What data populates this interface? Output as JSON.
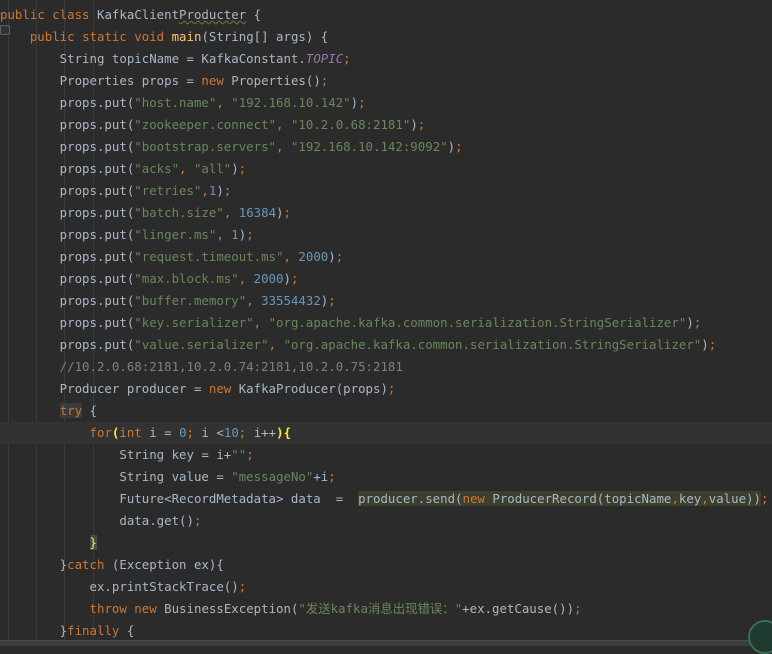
{
  "editor": {
    "lines": [
      [
        [
          "kw",
          "public "
        ],
        [
          "kw",
          "class "
        ],
        [
          "plain",
          "KafkaClient"
        ],
        [
          "wavy",
          "Producter"
        ],
        [
          "plain",
          " {"
        ]
      ],
      [
        [
          "plain",
          "    "
        ],
        [
          "kw",
          "public "
        ],
        [
          "kw",
          "static "
        ],
        [
          "kw",
          "void "
        ],
        [
          "fn",
          "main"
        ],
        [
          "plain",
          "(String[] args) {"
        ]
      ],
      [
        [
          "plain",
          "        String topicName = KafkaConstant."
        ],
        [
          "const",
          "TOPIC"
        ],
        [
          "kw",
          ";"
        ]
      ],
      [
        [
          "plain",
          "        Properties props = "
        ],
        [
          "kw",
          "new "
        ],
        [
          "plain",
          "Properties()"
        ],
        [
          "kw",
          ";"
        ]
      ],
      [
        [
          "plain",
          "        props.put("
        ],
        [
          "str",
          "\"host.name\""
        ],
        [
          "kw",
          ", "
        ],
        [
          "str",
          "\"192.168.10.142\""
        ],
        [
          "plain",
          ")"
        ],
        [
          "kw",
          ";"
        ]
      ],
      [
        [
          "plain",
          "        props.put("
        ],
        [
          "str",
          "\"zookeeper.connect\""
        ],
        [
          "kw",
          ", "
        ],
        [
          "str",
          "\"10.2.0.68:2181\""
        ],
        [
          "plain",
          ")"
        ],
        [
          "kw",
          ";"
        ]
      ],
      [
        [
          "plain",
          "        props.put("
        ],
        [
          "str",
          "\"bootstrap.servers\""
        ],
        [
          "kw",
          ", "
        ],
        [
          "str",
          "\"192.168.10.142:9092\""
        ],
        [
          "plain",
          ")"
        ],
        [
          "kw",
          ";"
        ]
      ],
      [
        [
          "plain",
          "        props.put("
        ],
        [
          "str",
          "\"acks\""
        ],
        [
          "kw",
          ", "
        ],
        [
          "str",
          "\"all\""
        ],
        [
          "plain",
          ")"
        ],
        [
          "kw",
          ";"
        ]
      ],
      [
        [
          "plain",
          "        props.put("
        ],
        [
          "str",
          "\"retries\""
        ],
        [
          "kw",
          ","
        ],
        [
          "num",
          "1"
        ],
        [
          "plain",
          ")"
        ],
        [
          "kw",
          ";"
        ]
      ],
      [
        [
          "plain",
          "        props.put("
        ],
        [
          "str",
          "\"batch.size\""
        ],
        [
          "kw",
          ", "
        ],
        [
          "num",
          "16384"
        ],
        [
          "plain",
          ")"
        ],
        [
          "kw",
          ";"
        ]
      ],
      [
        [
          "plain",
          "        props.put("
        ],
        [
          "str",
          "\"linger.ms\""
        ],
        [
          "kw",
          ", "
        ],
        [
          "num",
          "1"
        ],
        [
          "plain",
          ")"
        ],
        [
          "kw",
          ";"
        ]
      ],
      [
        [
          "plain",
          "        props.put("
        ],
        [
          "str",
          "\"request.timeout.ms\""
        ],
        [
          "kw",
          ", "
        ],
        [
          "num",
          "2000"
        ],
        [
          "plain",
          ")"
        ],
        [
          "kw",
          ";"
        ]
      ],
      [
        [
          "plain",
          "        props.put("
        ],
        [
          "str",
          "\"max.block.ms\""
        ],
        [
          "kw",
          ", "
        ],
        [
          "num",
          "2000"
        ],
        [
          "plain",
          ")"
        ],
        [
          "kw",
          ";"
        ]
      ],
      [
        [
          "plain",
          "        props.put("
        ],
        [
          "str",
          "\"buffer.memory\""
        ],
        [
          "kw",
          ", "
        ],
        [
          "num",
          "33554432"
        ],
        [
          "plain",
          ")"
        ],
        [
          "kw",
          ";"
        ]
      ],
      [
        [
          "plain",
          "        props.put("
        ],
        [
          "str",
          "\"key.serializer\""
        ],
        [
          "kw",
          ", "
        ],
        [
          "str",
          "\"org.apache.kafka.common.serialization.StringSerializer\""
        ],
        [
          "plain",
          ")"
        ],
        [
          "kw",
          ";"
        ]
      ],
      [
        [
          "plain",
          "        props.put("
        ],
        [
          "str",
          "\"value.serializer\""
        ],
        [
          "kw",
          ", "
        ],
        [
          "str",
          "\"org.apache.kafka.common.serialization.StringSerializer\""
        ],
        [
          "plain",
          ")"
        ],
        [
          "kw",
          ";"
        ]
      ],
      [
        [
          "cmt",
          "        //10.2.0.68:2181,10.2.0.74:2181,10.2.0.75:2181"
        ]
      ],
      [
        [
          "plain",
          "        Producer producer = "
        ],
        [
          "kw",
          "new "
        ],
        [
          "plain",
          "KafkaProducer(props)"
        ],
        [
          "kw",
          ";"
        ]
      ],
      [
        [
          "plain",
          "        "
        ],
        [
          "try-hl",
          "try"
        ],
        [
          "plain",
          " {"
        ]
      ],
      [
        [
          "plain",
          "            "
        ],
        [
          "kw",
          "for"
        ],
        [
          "brace-hl",
          "("
        ],
        [
          "kw",
          "int "
        ],
        [
          "plain",
          "i = "
        ],
        [
          "num",
          "0"
        ],
        [
          "kw",
          "; "
        ],
        [
          "plain",
          "i <"
        ],
        [
          "num",
          "10"
        ],
        [
          "kw",
          "; "
        ],
        [
          "plain",
          "i++"
        ],
        [
          "brace-hl",
          ")"
        ],
        [
          "brace-hl",
          "{"
        ]
      ],
      [
        [
          "plain",
          "                String key = i+"
        ],
        [
          "str",
          "\"\""
        ],
        [
          "kw",
          ";"
        ]
      ],
      [
        [
          "plain",
          "                String value = "
        ],
        [
          "str",
          "\"messageNo\""
        ],
        [
          "plain",
          "+i"
        ],
        [
          "kw",
          ";"
        ]
      ],
      [
        [
          "plain",
          "                Future<RecordMetadata> data  =  "
        ],
        [
          "send-hl",
          "producer.send("
        ],
        [
          "kw-send",
          "new "
        ],
        [
          "send-hl",
          "ProducerRecord(topicName"
        ],
        [
          "kw-send",
          ","
        ],
        [
          "send-hl",
          "key"
        ],
        [
          "kw-send",
          ","
        ],
        [
          "send-hl",
          "value))"
        ],
        [
          "kw",
          ";"
        ]
      ],
      [
        [
          "plain",
          "                data.get()"
        ],
        [
          "kw",
          ";"
        ]
      ],
      [
        [
          "plain",
          "            "
        ],
        [
          "brace-box",
          "}"
        ]
      ],
      [
        [
          "plain",
          "        }"
        ],
        [
          "kw",
          "catch "
        ],
        [
          "plain",
          "(Exception ex){"
        ]
      ],
      [
        [
          "plain",
          "            ex.printStackTrace()"
        ],
        [
          "kw",
          ";"
        ]
      ],
      [
        [
          "plain",
          "            "
        ],
        [
          "kw",
          "throw "
        ],
        [
          "kw",
          "new "
        ],
        [
          "plain",
          "BusinessException("
        ],
        [
          "str",
          "\"发送kafka消息出现错误：\""
        ],
        [
          "plain",
          "+ex.getCause())"
        ],
        [
          "kw",
          ";"
        ]
      ],
      [
        [
          "plain",
          "        }"
        ],
        [
          "kw",
          "finally "
        ],
        [
          "plain",
          "{"
        ]
      ]
    ],
    "current_line": 19
  }
}
